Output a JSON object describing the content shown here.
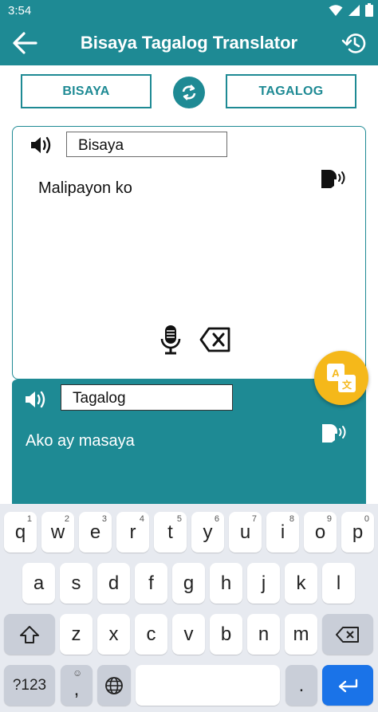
{
  "status_bar": {
    "time": "3:54"
  },
  "app_bar": {
    "title": "Bisaya Tagalog Translator"
  },
  "languages": {
    "source_button": "BISAYA",
    "target_button": "TAGALOG"
  },
  "source": {
    "language_label": "Bisaya",
    "text": "Malipayon ko"
  },
  "target": {
    "language_label": "Tagalog",
    "text": "Ako ay masaya"
  },
  "keyboard": {
    "row1": [
      {
        "key": "q",
        "hint": "1"
      },
      {
        "key": "w",
        "hint": "2"
      },
      {
        "key": "e",
        "hint": "3"
      },
      {
        "key": "r",
        "hint": "4"
      },
      {
        "key": "t",
        "hint": "5"
      },
      {
        "key": "y",
        "hint": "6"
      },
      {
        "key": "u",
        "hint": "7"
      },
      {
        "key": "i",
        "hint": "8"
      },
      {
        "key": "o",
        "hint": "9"
      },
      {
        "key": "p",
        "hint": "0"
      }
    ],
    "row2": [
      "a",
      "s",
      "d",
      "f",
      "g",
      "h",
      "j",
      "k",
      "l"
    ],
    "row3": [
      "z",
      "x",
      "c",
      "v",
      "b",
      "n",
      "m"
    ],
    "symbols_label": "?123",
    "comma": ",",
    "comma_hint": "☺",
    "period": "."
  },
  "colors": {
    "primary": "#1e8a94",
    "accent": "#f5b81a",
    "enter": "#1a73e8"
  }
}
